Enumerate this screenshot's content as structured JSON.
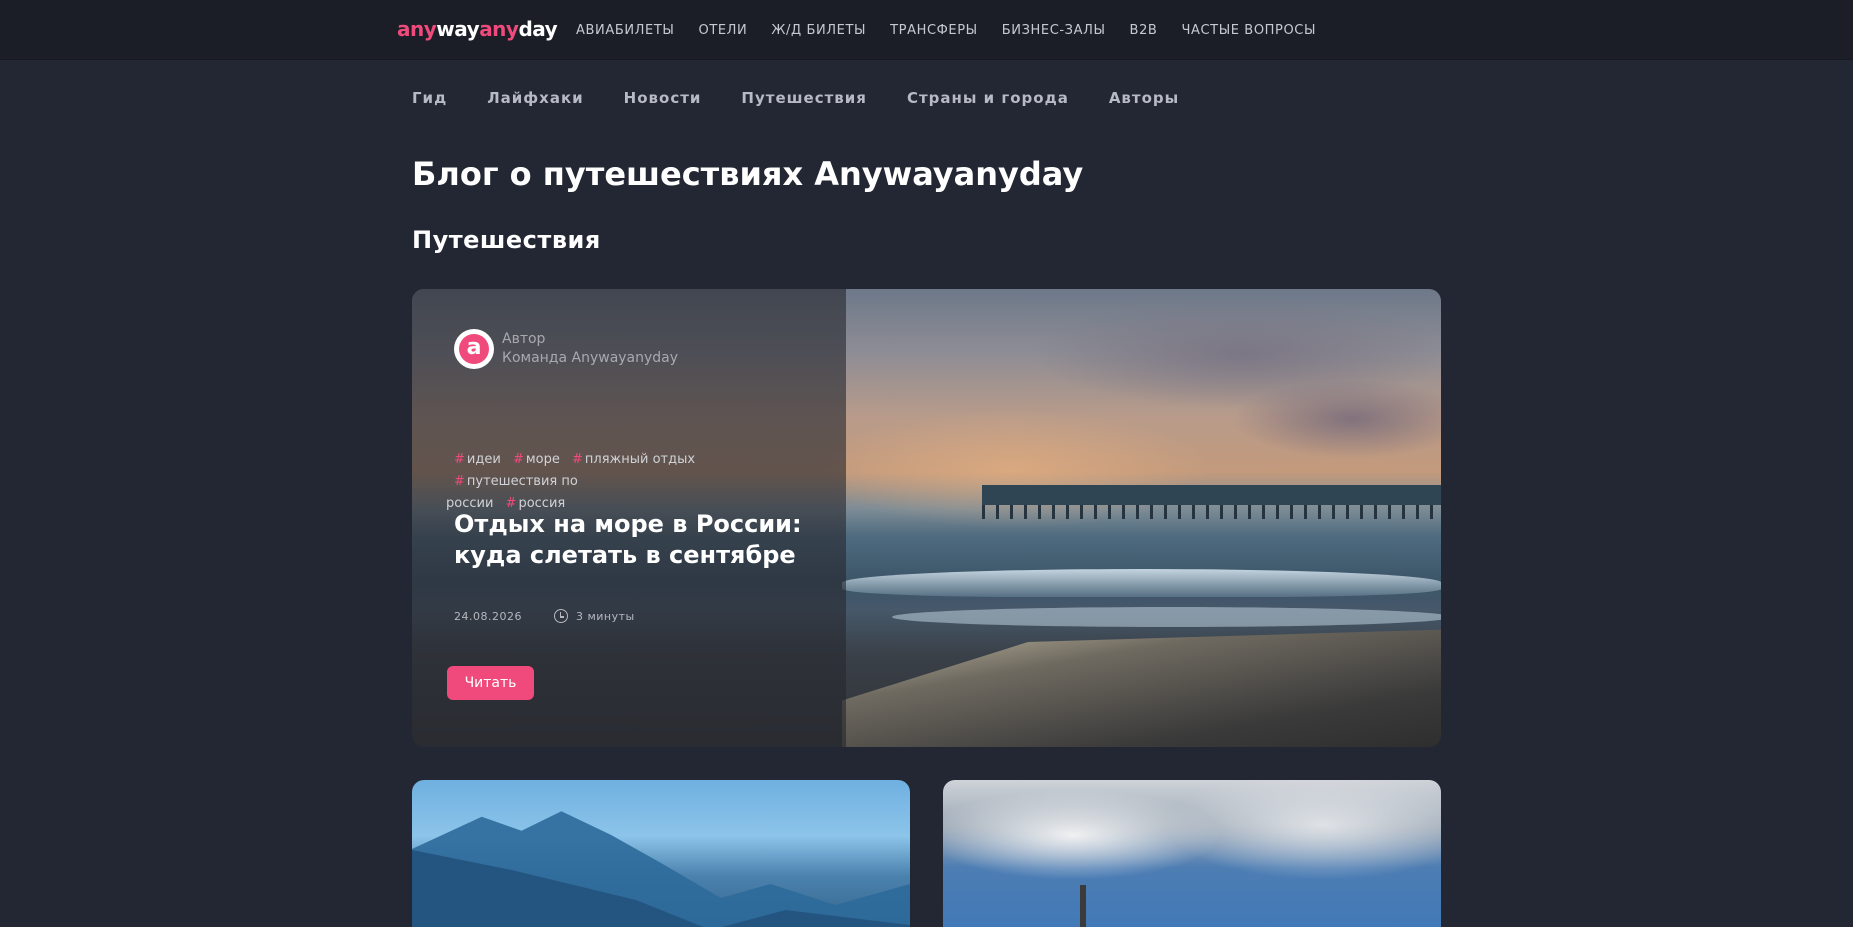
{
  "header": {
    "logo": {
      "part1": "any",
      "part2": "way",
      "part3": "any",
      "part4": "day"
    },
    "nav": [
      "АВИАБИЛЕТЫ",
      "ОТЕЛИ",
      "Ж/Д БИЛЕТЫ",
      "ТРАНСФЕРЫ",
      "БИЗНЕС-ЗАЛЫ",
      "B2B",
      "ЧАСТЫЕ ВОПРОСЫ"
    ]
  },
  "subnav": [
    "Гид",
    "Лайфхаки",
    "Новости",
    "Путешествия",
    "Страны и города",
    "Авторы"
  ],
  "page_title": "Блог о путешествиях Anywayanyday",
  "section_title": "Путешествия",
  "featured": {
    "author_role": "Автор",
    "author_name": "Команда Anywayanyday",
    "avatar_letter": "a",
    "tag_hash": "#",
    "tags": [
      "идеи",
      "море",
      "пляжный отдых",
      "путешествия по",
      "россии",
      "россия"
    ],
    "title": "Отдых на море в России: куда слетать в сентябре",
    "date": "24.08.2026",
    "read_time": "3 минуты",
    "read_button": "Читать"
  },
  "colors": {
    "accent": "#ef4a7b",
    "background": "#232733",
    "header_background": "#1b1e27"
  }
}
